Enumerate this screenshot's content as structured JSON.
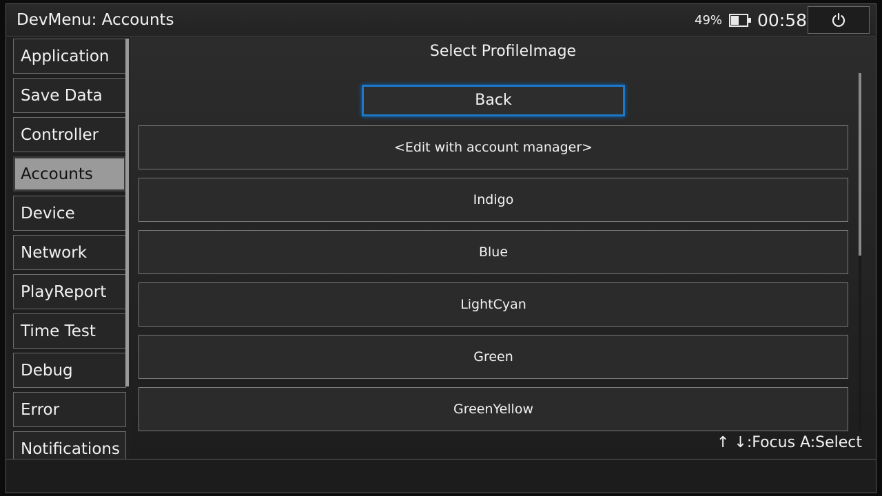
{
  "header": {
    "title": "DevMenu: Accounts",
    "battery_percent": "49%",
    "battery_level": 0.49,
    "clock": "00:58",
    "power_icon": "power-icon"
  },
  "sidebar": {
    "items": [
      {
        "label": "Application"
      },
      {
        "label": "Save Data"
      },
      {
        "label": "Controller"
      },
      {
        "label": "Accounts",
        "active": true
      },
      {
        "label": "Device"
      },
      {
        "label": "Network"
      },
      {
        "label": "PlayReport"
      },
      {
        "label": "Time Test"
      },
      {
        "label": "Debug"
      },
      {
        "label": "Error"
      },
      {
        "label": "Notifications"
      }
    ]
  },
  "main": {
    "title": "Select ProfileImage",
    "back_label": "Back",
    "items": [
      {
        "label": "<Edit with account manager>"
      },
      {
        "label": "Indigo"
      },
      {
        "label": "Blue"
      },
      {
        "label": "LightCyan"
      },
      {
        "label": "Green"
      },
      {
        "label": "GreenYellow"
      }
    ],
    "hint": "↑ ↓:Focus   A:Select"
  },
  "colors": {
    "focus_accent": "#1e78c8",
    "active_sidebar_bg": "#9a9a9a"
  }
}
